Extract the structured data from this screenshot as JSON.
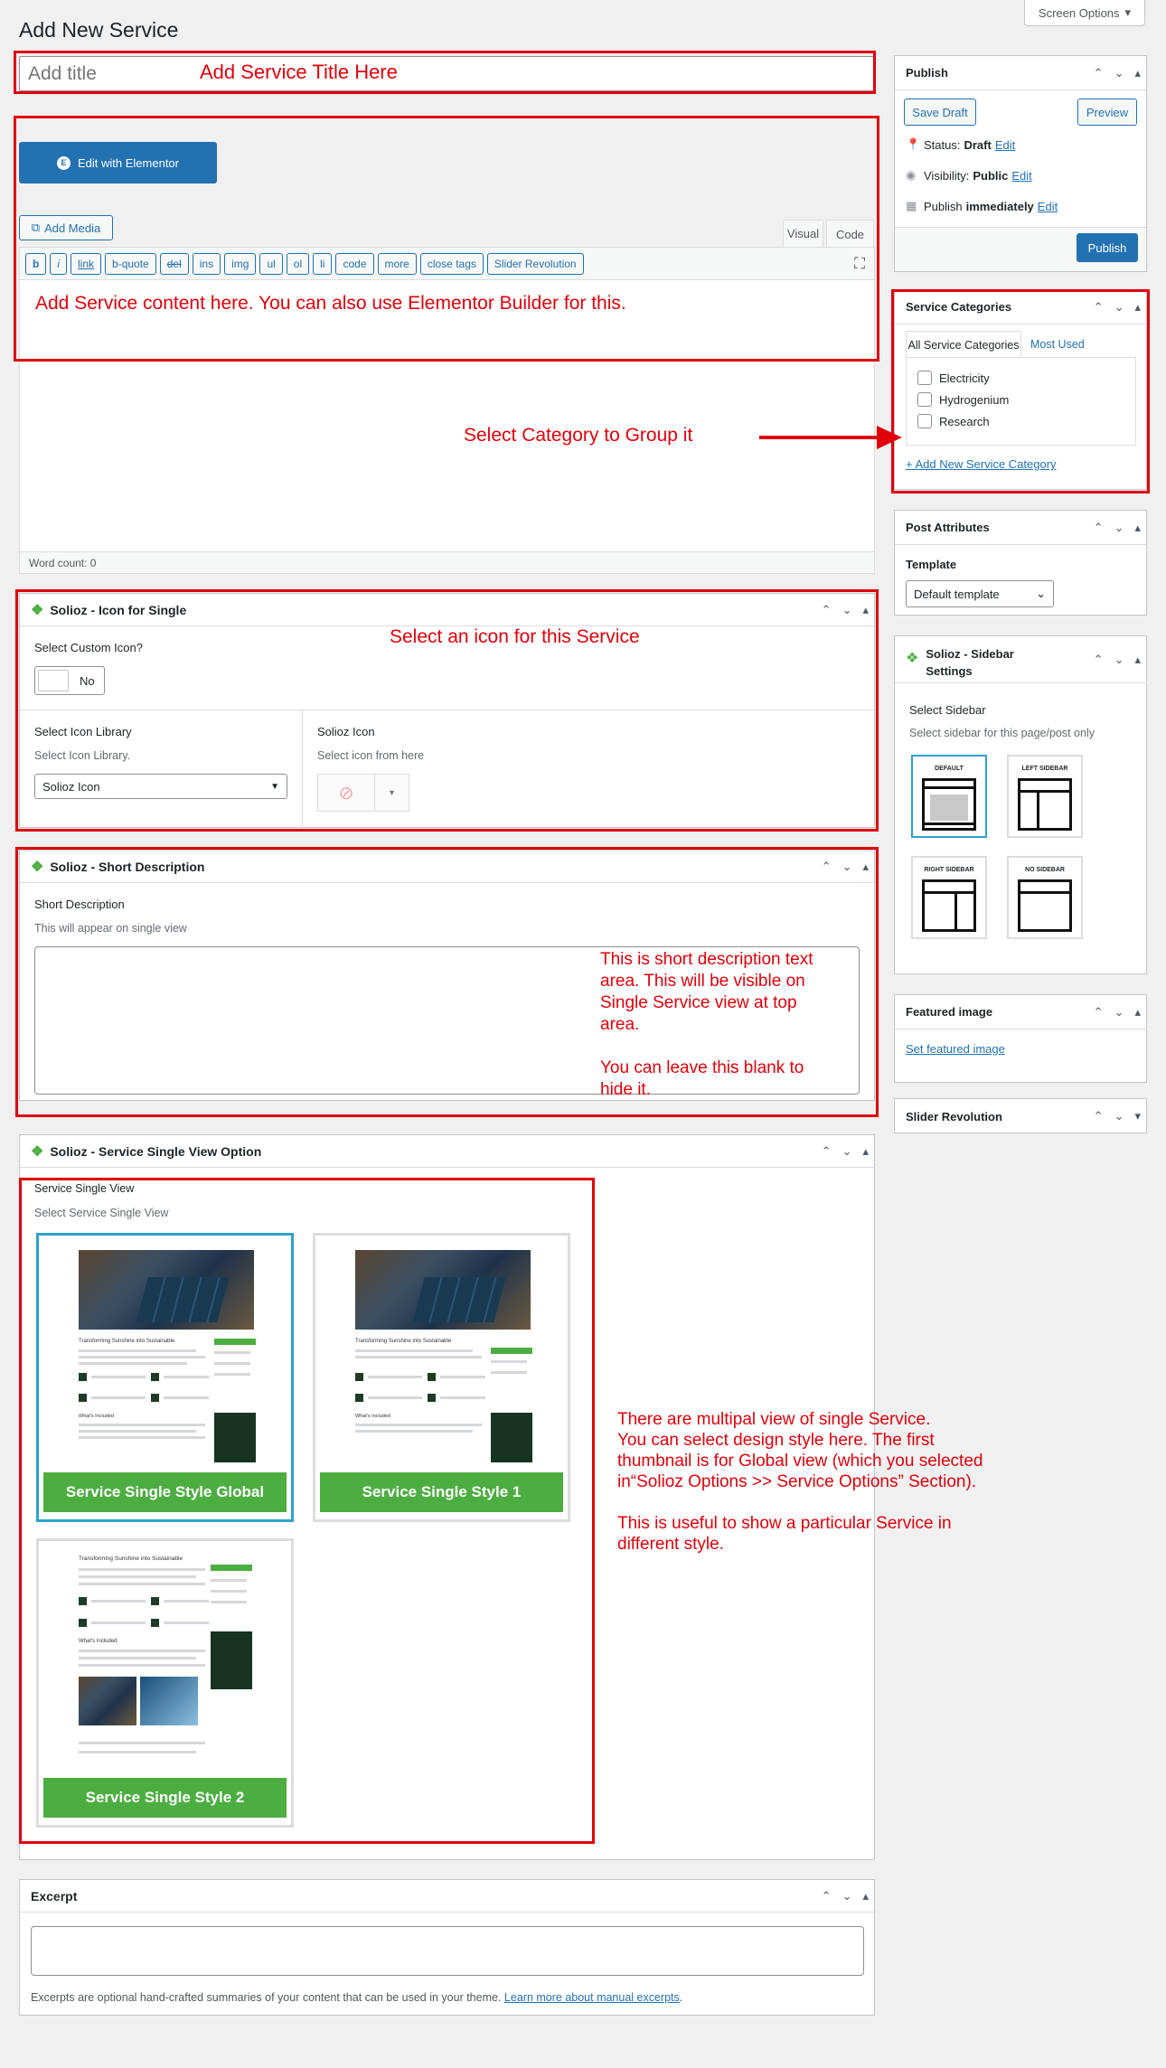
{
  "page": {
    "title": "Add New Service",
    "screen_options": "Screen Options"
  },
  "title_field": {
    "placeholder": "Add title"
  },
  "editor": {
    "elementor_button": "Edit with Elementor",
    "add_media": "Add Media",
    "tab_visual": "Visual",
    "tab_code": "Code",
    "quicktags": [
      "b",
      "i",
      "link",
      "b-quote",
      "del",
      "ins",
      "img",
      "ul",
      "ol",
      "li",
      "code",
      "more",
      "close tags",
      "Slider Revolution"
    ],
    "word_count": "Word count: 0"
  },
  "publish": {
    "title": "Publish",
    "save_draft": "Save Draft",
    "preview": "Preview",
    "status_label": "Status:",
    "status_value": "Draft",
    "visibility_label": "Visibility:",
    "visibility_value": "Public",
    "publish_label": "Publish",
    "publish_value": "immediately",
    "edit": "Edit",
    "publish_button": "Publish"
  },
  "categories": {
    "title": "Service Categories",
    "tab_all": "All Service Categories",
    "tab_most": "Most Used",
    "items": [
      "Electricity",
      "Hydrogenium",
      "Research"
    ],
    "add_new": "+ Add New Service Category"
  },
  "attributes": {
    "title": "Post Attributes",
    "template_label": "Template",
    "template_value": "Default template"
  },
  "sidebar_settings": {
    "title_line1": "Solioz - Sidebar",
    "title_line2": "Settings",
    "select_label": "Select Sidebar",
    "select_sub": "Select sidebar for this page/post only",
    "options": [
      "DEFAULT",
      "LEFT SIDEBAR",
      "RIGHT SIDEBAR",
      "NO SIDEBAR"
    ]
  },
  "featured": {
    "title": "Featured image",
    "link": "Set featured image"
  },
  "slider_rev": {
    "title": "Slider Revolution"
  },
  "icon_box": {
    "title": "Solioz - Icon for Single",
    "custom_icon_label": "Select Custom Icon?",
    "toggle_value": "No",
    "library_label": "Select Icon Library",
    "library_sub": "Select Icon Library.",
    "library_value": "Solioz Icon",
    "icon_label": "Solioz Icon",
    "icon_sub": "Select icon from here"
  },
  "short_desc": {
    "title": "Solioz - Short Description",
    "label": "Short Description",
    "sub": "This will appear on single view"
  },
  "single_view": {
    "title": "Solioz - Service Single View Option",
    "label": "Service Single View",
    "sub": "Select Service Single View",
    "styles": [
      "Service Single Style Global",
      "Service Single Style 1",
      "Service Single Style 2"
    ],
    "thumb_heading": "Transforming Sunshine into Sustainable",
    "thumb_section": "What's Included"
  },
  "excerpt": {
    "title": "Excerpt",
    "help": "Excerpts are optional hand-crafted summaries of your content that can be used in your theme.",
    "link": "Learn more about manual excerpts"
  },
  "annotations": {
    "title": "Add Service Title Here",
    "content": "Add Service content here. You can also use Elementor Builder for this.",
    "category": "Select Category to Group it",
    "icon": "Select an icon for this Service",
    "short_desc": [
      "This is short description text",
      "area. This will be visible on",
      "Single Service view at top",
      "area.",
      "",
      "You can leave this blank to",
      "hide it."
    ],
    "single_view": [
      "There are multipal view of single Service.",
      "You can select design style here. The first",
      "thumbnail is for Global view (which you selected",
      "in“Solioz Options >> Service Options” Section).",
      "",
      "This is useful to show a particular Service in",
      "different style."
    ]
  },
  "colors": {
    "accent": "#2271b1",
    "annotation": "#e0000a",
    "style_label": "#4cae40",
    "selected": "#2ea2cc"
  },
  "icons": [
    "chevron-up-icon",
    "chevron-down-icon",
    "caret-up-icon",
    "pin-icon",
    "eye-icon",
    "calendar-icon",
    "fullscreen-icon",
    "elementor-icon",
    "media-icon",
    "solioz-logo-icon",
    "ban-icon"
  ]
}
